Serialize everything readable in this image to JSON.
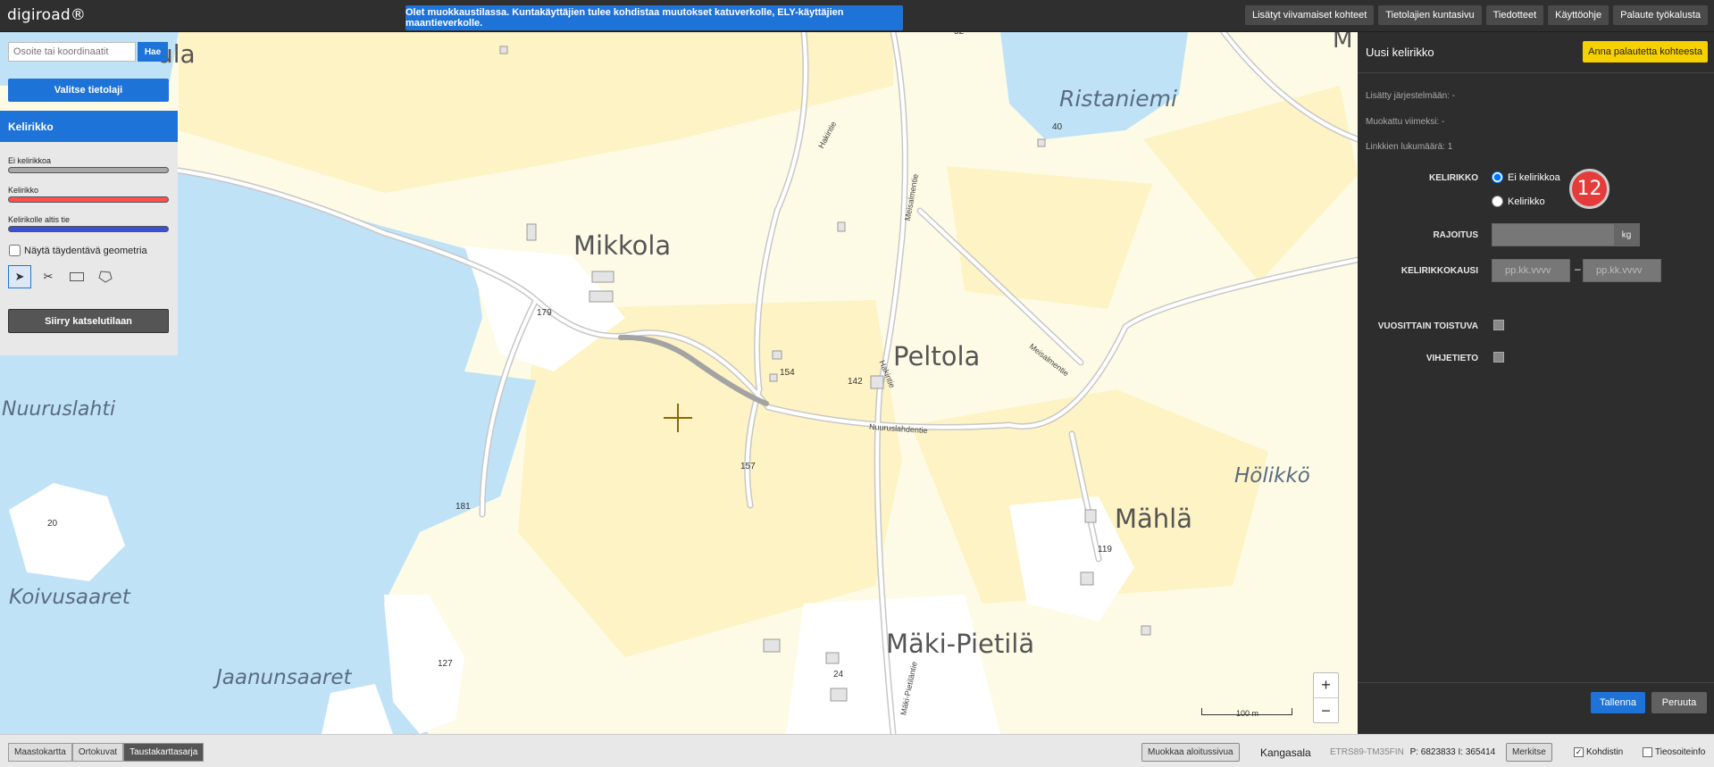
{
  "topbar": {
    "logo": "digiroad®",
    "notice": "Olet muokkaustilassa. Kuntakäyttäjien tulee kohdistaa muutokset katuverkolle, ELY-käyttäjien maantieverkolle.",
    "links": [
      "Lisätyt viivamaiset kohteet",
      "Tietolajien kuntasivu",
      "Tiedotteet",
      "Käyttöohje",
      "Palaute työkalusta"
    ]
  },
  "left": {
    "search_placeholder": "Osoite tai koordinaatit",
    "search_button": "Hae",
    "select_layer": "Valitse tietolaji",
    "layer_title": "Kelirikko",
    "legend": [
      {
        "label": "Ei kelirikkoa",
        "color": "#a8a8a8"
      },
      {
        "label": "Kelirikko",
        "color": "#ff4f4f"
      },
      {
        "label": "Kelirikolle altis tie",
        "color": "#3b4fd6"
      }
    ],
    "show_geometry": "Näytä täydentävä geometria",
    "view_mode_button": "Siirry katselutilaan"
  },
  "map": {
    "places": [
      {
        "text": "ula",
        "cls": ""
      },
      {
        "text": "Ristaniemi",
        "cls": "water"
      },
      {
        "text": "Mikkola",
        "cls": ""
      },
      {
        "text": "Peltola",
        "cls": ""
      },
      {
        "text": "Nuuruslahti",
        "cls": "water"
      },
      {
        "text": "Hölikkö",
        "cls": "water"
      },
      {
        "text": "Mählä",
        "cls": ""
      },
      {
        "text": "Koivusaaret",
        "cls": "water"
      },
      {
        "text": "Mäki-Pietilä",
        "cls": ""
      },
      {
        "text": "Jaanunsaaret",
        "cls": "water"
      },
      {
        "text": "M",
        "cls": ""
      }
    ],
    "numbers": [
      "40",
      "179",
      "154",
      "142",
      "157",
      "181",
      "20",
      "119",
      "127",
      "24",
      "52"
    ],
    "roads": [
      "Hakintie",
      "Meisalmentie",
      "Meisalmentie",
      "Hakintie",
      "Nuuruslahdentie",
      "Mäki-Pietiläntie"
    ],
    "scale": "100 m"
  },
  "right": {
    "title": "Uusi kelirikko",
    "feedback_button": "Anna palautetta kohteesta",
    "added": "Lisätty järjestelmään: -",
    "modified": "Muokattu viimeksi: -",
    "links_count": "Linkkien lukumäärä: 1",
    "kelirikko_label": "KELIRIKKO",
    "option_none": "Ei kelirikkoa",
    "option_yes": "Kelirikko",
    "badge": "12",
    "limit_label": "RAJOITUS",
    "limit_unit": "kg",
    "period_label": "KELIRIKKOKAUSI",
    "date_placeholder": "pp.kk.vvvv",
    "yearly_label": "VUOSITTAIN TOISTUVA",
    "hint_label": "VIHJETIETO",
    "save": "Tallenna",
    "cancel": "Peruuta"
  },
  "bottom": {
    "basemaps": [
      "Maastokartta",
      "Ortokuvat",
      "Taustakarttasarja"
    ],
    "edit_start": "Muokkaa aloitussivua",
    "municipality": "Kangasala",
    "projection": "ETRS89-TM35FIN",
    "coords": "P: 6823833  I: 365414",
    "mark": "Merkitse",
    "cursor": "Kohdistin",
    "info": "Tieosoiteinfo"
  }
}
